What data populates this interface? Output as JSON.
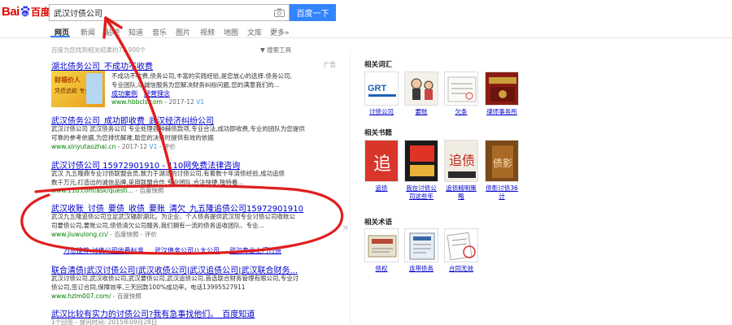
{
  "header": {
    "logo_left": "Bai",
    "logo_right": "百度",
    "search_value": "武汉讨债公司",
    "search_button": "百度一下"
  },
  "tabs": [
    {
      "label": "网页",
      "active": true
    },
    {
      "label": "新闻"
    },
    {
      "label": "贴吧"
    },
    {
      "label": "知道"
    },
    {
      "label": "音乐"
    },
    {
      "label": "图片"
    },
    {
      "label": "视频"
    },
    {
      "label": "地图"
    },
    {
      "label": "文库"
    },
    {
      "label": "更多»"
    }
  ],
  "meta": {
    "count_text": "百度为您找到相关结果约71,900个",
    "search_tools": "搜索工具"
  },
  "results": {
    "r1": {
      "title": "湖北债务公司_不成功不收费",
      "ad": "广告",
      "thumb_line1": "财福价人",
      "thumb_line2": "凭债追款 专业",
      "desc_line1": "不成功不收费,债务公司,丰富的实践经验,是您放心的选择.债务公司,",
      "desc_line2": "专业团队,以诚信服务为您解决财务纠纷问题,您的满意我们的...",
      "link1": "成功案例",
      "link2": "经营理念",
      "url": "www.hbbcls.com",
      "date": "2017-12",
      "vtag": "V1"
    },
    "r2": {
      "title": "武汉债务公司_成功即收费_武汉经济纠纷公司",
      "desc_line1": "武汉讨债公司 武汉债务公司 专业处理各种棘债款项,专业合法,成功即收费,专业的团队为您提供",
      "desc_line2": "可靠的参考依据,为您排忧解难,助您的决策时提供有效的依据",
      "url": "www.xinyutaozhai.cn",
      "date": "2017-12",
      "vtag": "V1",
      "eval": "评价"
    },
    "r3": {
      "title": "武汉讨债公司 15972901910 - 110网免费法律咨询",
      "desc_line1": "武汉 九五隆鼎专业讨债联盟会员,致力于湖北的讨债公司,有着数十年清债经验,成功追债",
      "desc_line2": "数千万元,打造出的诚信品牌,采用联盟合作,专业团队,合法快捷,独特看...",
      "url": "www.110.com/ask/questi...",
      "snapshot": "百度快照"
    },
    "r4": {
      "title": "武汉收账_讨债_要债_收债_要账_清欠_九五隆追债公司15972901910",
      "desc_line1": "武汉九五隆追债公司立足武汉辐射湖北。为企业、个人债务提供武汉现专业讨债公司收账公",
      "desc_line2": "司要债公司,要账公司,债债清欠公司服务,我们拥有一流的债务追收团队、专业...",
      "url": "www.jiuwulong.cn/",
      "snapshot": "百度快照",
      "eval": "评价"
    },
    "sub_links": {
      "l1": "为您推荐:讨债公司收费标准",
      "l2": "武汉债务公司八大公司",
      "l3": "武汉专业上门讨债"
    },
    "r5": {
      "title": "联合清债|武汉讨债公司|武汉收债公司|武汉追债公司|武汉联合财务...",
      "desc_line1": "武汉讨债公司,武汉收债公司,武汉要债公司,武汉追债公司,首选联合财务管理有限公司,专业讨",
      "desc_line2": "债公司,签订合同,保障效率,三天回款100%成功率。电话13995527911",
      "url": "www.hzlm007.com/",
      "snapshot": "百度快照"
    },
    "r6": {
      "title": "武汉比较有实力的讨债公司?我有急事找他们。_百度知道",
      "meta": "1个回答 - 提问时间: 2015年09月28日"
    }
  },
  "right": {
    "section1": "相关词汇",
    "cards1": [
      {
        "label": "讨债公司",
        "icon": "collection-agency-logo-icon"
      },
      {
        "label": "要账",
        "icon": "collect-debt-cartoon-icon"
      },
      {
        "label": "欠条",
        "icon": "iou-note-icon"
      },
      {
        "label": "律师事务所",
        "icon": "law-firm-sign-icon"
      }
    ],
    "section2": "相关书籍",
    "cards2": [
      {
        "label": "追债",
        "icon": "book-cover-icon"
      },
      {
        "label": "我在讨债公司这些年",
        "icon": "book-cover-icon"
      },
      {
        "label": "追债精明策略",
        "icon": "book-cover-icon"
      },
      {
        "label": "债影讨债36计",
        "icon": "book-cover-icon"
      }
    ],
    "section3": "相关术语",
    "cards3": [
      {
        "label": "债权",
        "icon": "bond-certificate-icon"
      },
      {
        "label": "连带债务",
        "icon": "contract-document-icon"
      },
      {
        "label": "合同无效",
        "icon": "contract-stamp-icon"
      }
    ]
  },
  "colors": {
    "link": "#0000cc",
    "highlight": "#cc0000",
    "url": "#008000",
    "button": "#3385ff",
    "annotation": "#e01d1d"
  }
}
